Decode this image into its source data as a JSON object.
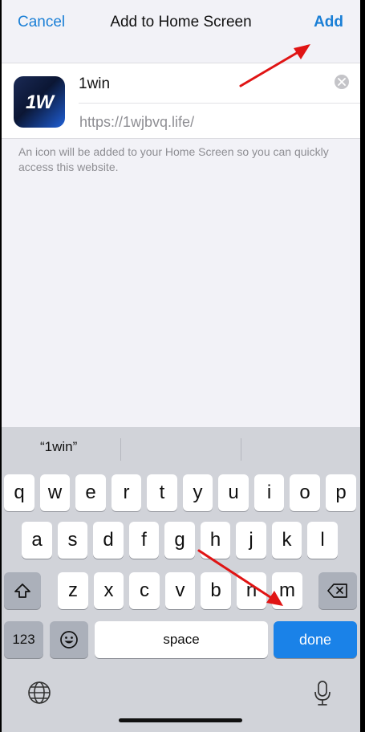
{
  "nav": {
    "cancel_label": "Cancel",
    "title": "Add to Home Screen",
    "add_label": "Add"
  },
  "bookmark": {
    "icon_mark": "1W",
    "name": "1win",
    "url": "https://1wjbvq.life/",
    "hint": "An icon will be added to your Home Screen so you can quickly access this website."
  },
  "keyboard": {
    "suggestions": [
      "“1win”",
      "",
      ""
    ],
    "row1": [
      "q",
      "w",
      "e",
      "r",
      "t",
      "y",
      "u",
      "i",
      "o",
      "p"
    ],
    "row2": [
      "a",
      "s",
      "d",
      "f",
      "g",
      "h",
      "j",
      "k",
      "l"
    ],
    "row3": [
      "z",
      "x",
      "c",
      "v",
      "b",
      "n",
      "m"
    ],
    "numbers_label": "123",
    "space_label": "space",
    "done_label": "done"
  },
  "icons": {
    "clear": "clear-circle-icon",
    "shift": "shift-icon",
    "delete": "backspace-icon",
    "emoji": "emoji-icon",
    "globe": "globe-icon",
    "mic": "microphone-icon",
    "annotation": "red-arrow-icon"
  },
  "colors": {
    "accent": "#1a7fd6",
    "done_key": "#1a82e8",
    "annotation": "#e01414"
  }
}
